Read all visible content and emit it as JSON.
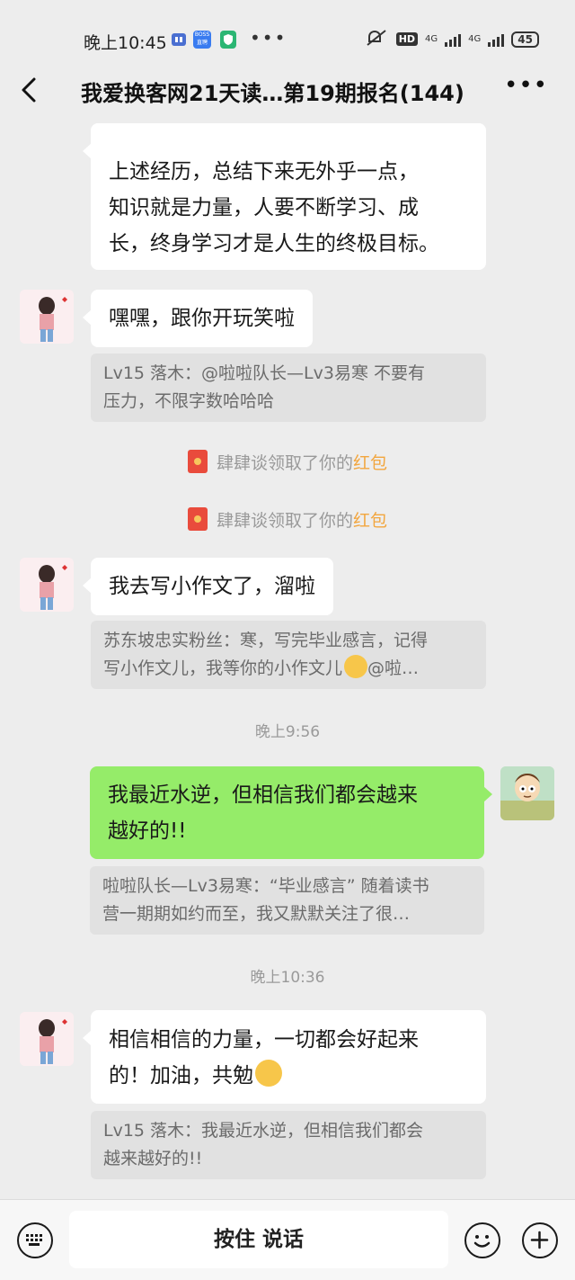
{
  "status_bar": {
    "time": "晚上10:45",
    "boss_badge_line1": "BOSS",
    "boss_badge_line2": "直聘",
    "hd": "HD",
    "net1": "4G",
    "net2": "4G",
    "battery": "45"
  },
  "header": {
    "title": "我爱换客网21天读…第19期报名(144)"
  },
  "messages": {
    "m1_line1": "上述经历，总结下来无外乎一点，",
    "m1_line2": "知识就是力量，人要不断学习、成",
    "m1_line3": "长，终身学习才是人生的终极目标。",
    "m2": "嘿嘿，跟你开玩笑啦",
    "q2_line1": "Lv15 落木：@啦啦队长—Lv3易寒 不要有",
    "q2_line2": "压力，不限字数哈哈哈",
    "sys1_text": "肆肆谈领取了你的",
    "sys1_link": "红包",
    "sys2_text": "肆肆谈领取了你的",
    "sys2_link": "红包",
    "m3": "我去写小作文了，溜啦",
    "q3_line1": "苏东坡忠实粉丝：寒，写完毕业感言，记得",
    "q3_line2a": "写小作文儿，我等你的小作文儿",
    "q3_line2b": "@啦…",
    "ts1": "晚上9:56",
    "m4_line1": "我最近水逆，但相信我们都会越来",
    "m4_line2": "越好的!!",
    "q4_line1": "啦啦队长—Lv3易寒：“毕业感言” 随着读书",
    "q4_line2": "营一期期如约而至，我又默默关注了很…",
    "ts2": "晚上10:36",
    "m5_line1": "相信相信的力量，一切都会好起来",
    "m5_line2": "的！加油，共勉",
    "q5_line1": "Lv15 落木：我最近水逆，但相信我们都会",
    "q5_line2": "越来越好的!!"
  },
  "input_bar": {
    "talk_label": "按住 说话"
  },
  "colors": {
    "background": "#ededed",
    "my_bubble": "#95ec69",
    "other_bubble": "#ffffff",
    "quote_bg": "#e1e1e1",
    "redpacket_link": "#f2a63f"
  },
  "icons": [
    "back-arrow-icon",
    "more-icon",
    "keyboard-icon",
    "emoji-icon",
    "plus-icon",
    "red-packet-icon"
  ]
}
